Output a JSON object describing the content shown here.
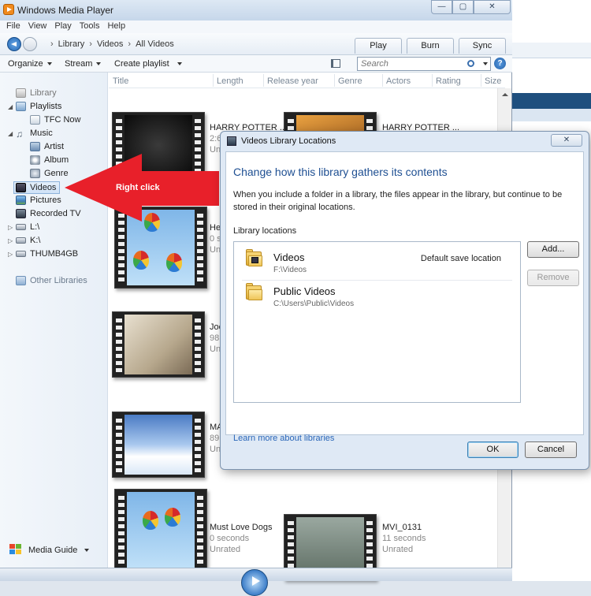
{
  "window": {
    "title": "Windows Media Player",
    "controls": {
      "minimize": "—",
      "maximize": "▢",
      "close": "✕"
    }
  },
  "menu": [
    "File",
    "View",
    "Play",
    "Tools",
    "Help"
  ],
  "breadcrumb": [
    "Library",
    "Videos",
    "All Videos"
  ],
  "tabs": [
    "Play",
    "Burn",
    "Sync"
  ],
  "toolbar": {
    "organize": "Organize",
    "stream": "Stream",
    "create_playlist": "Create playlist",
    "search_placeholder": "Search",
    "help": "?"
  },
  "nav": {
    "library": "Library",
    "playlists": "Playlists",
    "tfc_now": "TFC Now",
    "music": "Music",
    "artist": "Artist",
    "album": "Album",
    "genre": "Genre",
    "videos": "Videos",
    "pictures": "Pictures",
    "recorded_tv": "Recorded TV",
    "drive_l": "L:\\",
    "drive_k": "K:\\",
    "thumb": "THUMB4GB",
    "other_libraries": "Other Libraries",
    "media_guide": "Media Guide"
  },
  "columns": [
    "Title",
    "Length",
    "Release year",
    "Genre",
    "Actors",
    "Rating",
    "Size"
  ],
  "items": [
    {
      "title": "HARRY POTTER ...",
      "length": "2:6",
      "rating": "Un"
    },
    {
      "title": "HARRY POTTER ...",
      "length": "",
      "rating": ""
    },
    {
      "title": "He",
      "length": "0 s",
      "rating": "Un"
    },
    {
      "title": "Joe",
      "length": "98",
      "rating": "Un"
    },
    {
      "title": "MA",
      "length": "89",
      "rating": "Un"
    },
    {
      "title": "Must Love Dogs",
      "length": "0 seconds",
      "rating": "Unrated"
    },
    {
      "title": "MVI_0131",
      "length": "11 seconds",
      "rating": "Unrated"
    }
  ],
  "annotation": {
    "label": "Right click",
    "color": "#e8202a"
  },
  "dialog": {
    "title": "Videos Library Locations",
    "close": "✕",
    "heading": "Change how this library gathers its contents",
    "description": "When you include a folder in a library, the files appear in the library, but continue to be stored in their original locations.",
    "section": "Library locations",
    "locations": [
      {
        "name": "Videos",
        "path": "F:\\Videos",
        "note": "Default save location"
      },
      {
        "name": "Public Videos",
        "path": "C:\\Users\\Public\\Videos",
        "note": ""
      }
    ],
    "add": "Add...",
    "remove": "Remove",
    "learn_more": "Learn more about libraries",
    "ok": "OK",
    "cancel": "Cancel"
  },
  "colors": {
    "accent": "#1e4f92",
    "link": "#2a66b8",
    "annotation": "#e8202a"
  }
}
